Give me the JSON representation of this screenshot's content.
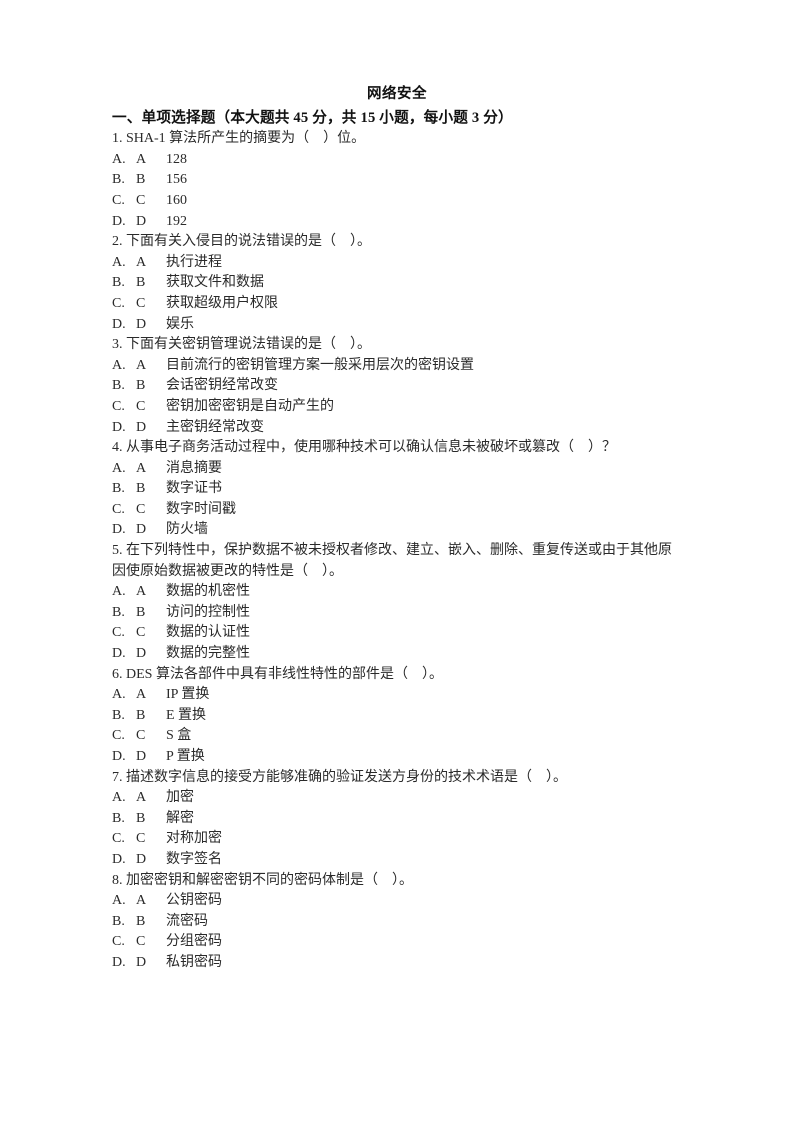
{
  "document": {
    "title": "网络安全",
    "section_heading": "一、单项选择题（本大题共 45 分，共 15 小题，每小题 3 分）",
    "section_meta": {
      "total_points": "45",
      "question_count": "15",
      "points_each": "3"
    }
  },
  "questions": [
    {
      "number": "1.",
      "text": "SHA-1 算法所产生的摘要为（　）位。",
      "wrap_style": "hang",
      "options": [
        {
          "marker": "A.",
          "letter": "A",
          "text": "128"
        },
        {
          "marker": "B.",
          "letter": "B",
          "text": "156"
        },
        {
          "marker": "C.",
          "letter": "C",
          "text": "160"
        },
        {
          "marker": "D.",
          "letter": "D",
          "text": "192"
        }
      ]
    },
    {
      "number": "2.",
      "text": "下面有关入侵目的说法错误的是（　）。",
      "wrap_style": "hang",
      "options": [
        {
          "marker": "A.",
          "letter": "A",
          "text": "执行进程"
        },
        {
          "marker": "B.",
          "letter": "B",
          "text": "获取文件和数据"
        },
        {
          "marker": "C.",
          "letter": "C",
          "text": "获取超级用户权限"
        },
        {
          "marker": "D.",
          "letter": "D",
          "text": "娱乐"
        }
      ]
    },
    {
      "number": "3.",
      "text": "下面有关密钥管理说法错误的是（　）。",
      "wrap_style": "hang",
      "options": [
        {
          "marker": "A.",
          "letter": "A",
          "text": "目前流行的密钥管理方案一般采用层次的密钥设置"
        },
        {
          "marker": "B.",
          "letter": "B",
          "text": "会话密钥经常改变"
        },
        {
          "marker": "C.",
          "letter": "C",
          "text": "密钥加密密钥是自动产生的"
        },
        {
          "marker": "D.",
          "letter": "D",
          "text": "主密钥经常改变"
        }
      ]
    },
    {
      "number": "4.",
      "text": "从事电子商务活动过程中，使用哪种技术可以确认信息未被破坏或篡改（　）？",
      "wrap_style": "hang",
      "options": [
        {
          "marker": "A.",
          "letter": "A",
          "text": "消息摘要"
        },
        {
          "marker": "B.",
          "letter": "B",
          "text": "数字证书"
        },
        {
          "marker": "C.",
          "letter": "C",
          "text": "数字时间戳"
        },
        {
          "marker": "D.",
          "letter": "D",
          "text": "防火墙"
        }
      ]
    },
    {
      "number": "5.",
      "text": "在下列特性中，保护数据不被未授权者修改、建立、嵌入、删除、重复传送或由于其他原因使原始数据被更改的特性是（　）。",
      "wrap_style": "flush",
      "options": [
        {
          "marker": "A.",
          "letter": "A",
          "text": "数据的机密性"
        },
        {
          "marker": "B.",
          "letter": "B",
          "text": "访问的控制性"
        },
        {
          "marker": "C.",
          "letter": "C",
          "text": "数据的认证性"
        },
        {
          "marker": "D.",
          "letter": "D",
          "text": "数据的完整性"
        }
      ]
    },
    {
      "number": "6.",
      "text": "DES 算法各部件中具有非线性特性的部件是（　）。",
      "wrap_style": "hang",
      "options": [
        {
          "marker": "A.",
          "letter": "A",
          "text": "IP 置换"
        },
        {
          "marker": "B.",
          "letter": "B",
          "text": "E 置换"
        },
        {
          "marker": "C.",
          "letter": "C",
          "text": "S 盒"
        },
        {
          "marker": "D.",
          "letter": "D",
          "text": "P 置换"
        }
      ]
    },
    {
      "number": "7.",
      "text": "描述数字信息的接受方能够准确的验证发送方身份的技术术语是（　）。",
      "wrap_style": "hang",
      "options": [
        {
          "marker": "A.",
          "letter": "A",
          "text": "加密"
        },
        {
          "marker": "B.",
          "letter": "B",
          "text": "解密"
        },
        {
          "marker": "C.",
          "letter": "C",
          "text": "对称加密"
        },
        {
          "marker": "D.",
          "letter": "D",
          "text": "数字签名"
        }
      ]
    },
    {
      "number": "8.",
      "text": "加密密钥和解密密钥不同的密码体制是（　）。",
      "wrap_style": "hang",
      "options": [
        {
          "marker": "A.",
          "letter": "A",
          "text": "公钥密码"
        },
        {
          "marker": "B.",
          "letter": "B",
          "text": "流密码"
        },
        {
          "marker": "C.",
          "letter": "C",
          "text": "分组密码"
        },
        {
          "marker": "D.",
          "letter": "D",
          "text": "私钥密码"
        }
      ]
    }
  ]
}
